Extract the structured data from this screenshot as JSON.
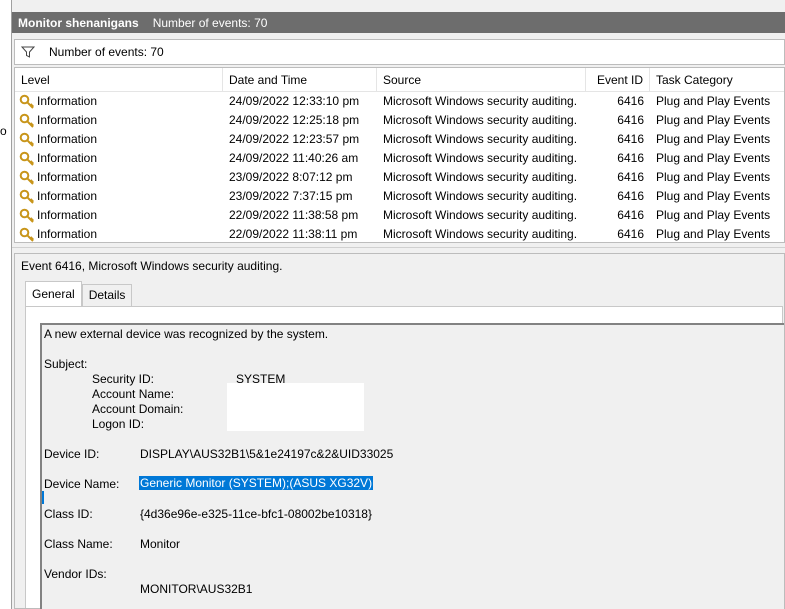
{
  "left_stub": "o",
  "header": {
    "title": "Monitor shenanigans",
    "count": "Number of events: 70"
  },
  "filter": {
    "count": "Number of events: 70"
  },
  "columns": {
    "level": "Level",
    "date": "Date and Time",
    "source": "Source",
    "event_id": "Event ID",
    "category": "Task Category"
  },
  "rows": [
    {
      "level": "Information",
      "date": "24/09/2022 12:33:10 pm",
      "source": "Microsoft Windows security auditing.",
      "event_id": "6416",
      "category": "Plug and Play Events"
    },
    {
      "level": "Information",
      "date": "24/09/2022 12:25:18 pm",
      "source": "Microsoft Windows security auditing.",
      "event_id": "6416",
      "category": "Plug and Play Events"
    },
    {
      "level": "Information",
      "date": "24/09/2022 12:23:57 pm",
      "source": "Microsoft Windows security auditing.",
      "event_id": "6416",
      "category": "Plug and Play Events"
    },
    {
      "level": "Information",
      "date": "24/09/2022 11:40:26 am",
      "source": "Microsoft Windows security auditing.",
      "event_id": "6416",
      "category": "Plug and Play Events"
    },
    {
      "level": "Information",
      "date": "23/09/2022 8:07:12 pm",
      "source": "Microsoft Windows security auditing.",
      "event_id": "6416",
      "category": "Plug and Play Events"
    },
    {
      "level": "Information",
      "date": "23/09/2022 7:37:15 pm",
      "source": "Microsoft Windows security auditing.",
      "event_id": "6416",
      "category": "Plug and Play Events"
    },
    {
      "level": "Information",
      "date": "22/09/2022 11:38:58 pm",
      "source": "Microsoft Windows security auditing.",
      "event_id": "6416",
      "category": "Plug and Play Events"
    },
    {
      "level": "Information",
      "date": "22/09/2022 11:38:11 pm",
      "source": "Microsoft Windows security auditing.",
      "event_id": "6416",
      "category": "Plug and Play Events"
    }
  ],
  "detail": {
    "title": "Event 6416, Microsoft Windows security auditing.",
    "tabs": {
      "general": "General",
      "details": "Details"
    },
    "intro": "A new external device was recognized by the system.",
    "subject_label": "Subject:",
    "security_id_label": "Security ID:",
    "security_id_value": "SYSTEM",
    "account_name_label": "Account Name:",
    "account_domain_label": "Account Domain:",
    "logon_id_label": "Logon ID:",
    "device_id_label": "Device ID:",
    "device_id_value": "DISPLAY\\AUS32B1\\5&1e24197c&2&UID33025",
    "device_name_label": "Device Name:",
    "device_name_value": "Generic Monitor (SYSTEM);(ASUS XG32V)",
    "class_id_label": "Class ID:",
    "class_id_value": "{4d36e96e-e325-11ce-bfc1-08002be10318}",
    "class_name_label": "Class Name:",
    "class_name_value": "Monitor",
    "vendor_ids_label": "Vendor IDs:",
    "vendor_ids_value": "MONITOR\\AUS32B1"
  },
  "icons": {
    "filter": "filter-funnel-icon",
    "level": "key-icon"
  },
  "colors": {
    "header_bg": "#6d6d6d",
    "selection": "#0078d7",
    "key_gold": "#d4a017"
  }
}
